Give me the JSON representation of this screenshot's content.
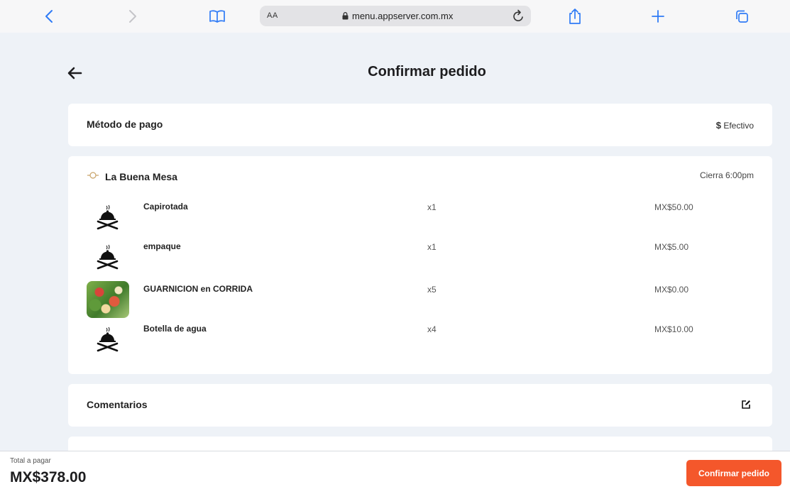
{
  "browser": {
    "text_size_label": "AA",
    "url": "menu.appserver.com.mx",
    "icons": [
      "back-icon",
      "forward-icon",
      "bookmarks-icon",
      "lock-icon",
      "reload-icon",
      "share-icon",
      "new-tab-icon",
      "tabs-icon"
    ]
  },
  "page": {
    "title": "Confirmar pedido"
  },
  "payment": {
    "label": "Método de pago",
    "symbol": "$",
    "value": "Efectivo"
  },
  "restaurant": {
    "name": "La Buena Mesa",
    "closing": "Cierra 6:00pm",
    "items": [
      {
        "name": "Capirotada",
        "qty": "x1",
        "price": "MX$50.00",
        "image": "dish-placeholder-icon"
      },
      {
        "name": "empaque",
        "qty": "x1",
        "price": "MX$5.00",
        "image": "dish-placeholder-icon"
      },
      {
        "name": "GUARNICION en CORRIDA",
        "qty": "x5",
        "price": "MX$0.00",
        "image": "salad-photo"
      },
      {
        "name": "Botella de agua",
        "qty": "x4",
        "price": "MX$10.00",
        "image": "dish-placeholder-icon"
      }
    ]
  },
  "comments": {
    "label": "Comentarios"
  },
  "footer": {
    "total_label": "Total a pagar",
    "total_value": "MX$378.00",
    "confirm_label": "Confirmar pedido"
  },
  "colors": {
    "accent": "#f4572b",
    "background": "#eef2f7",
    "link_blue": "#2f7bf6"
  }
}
